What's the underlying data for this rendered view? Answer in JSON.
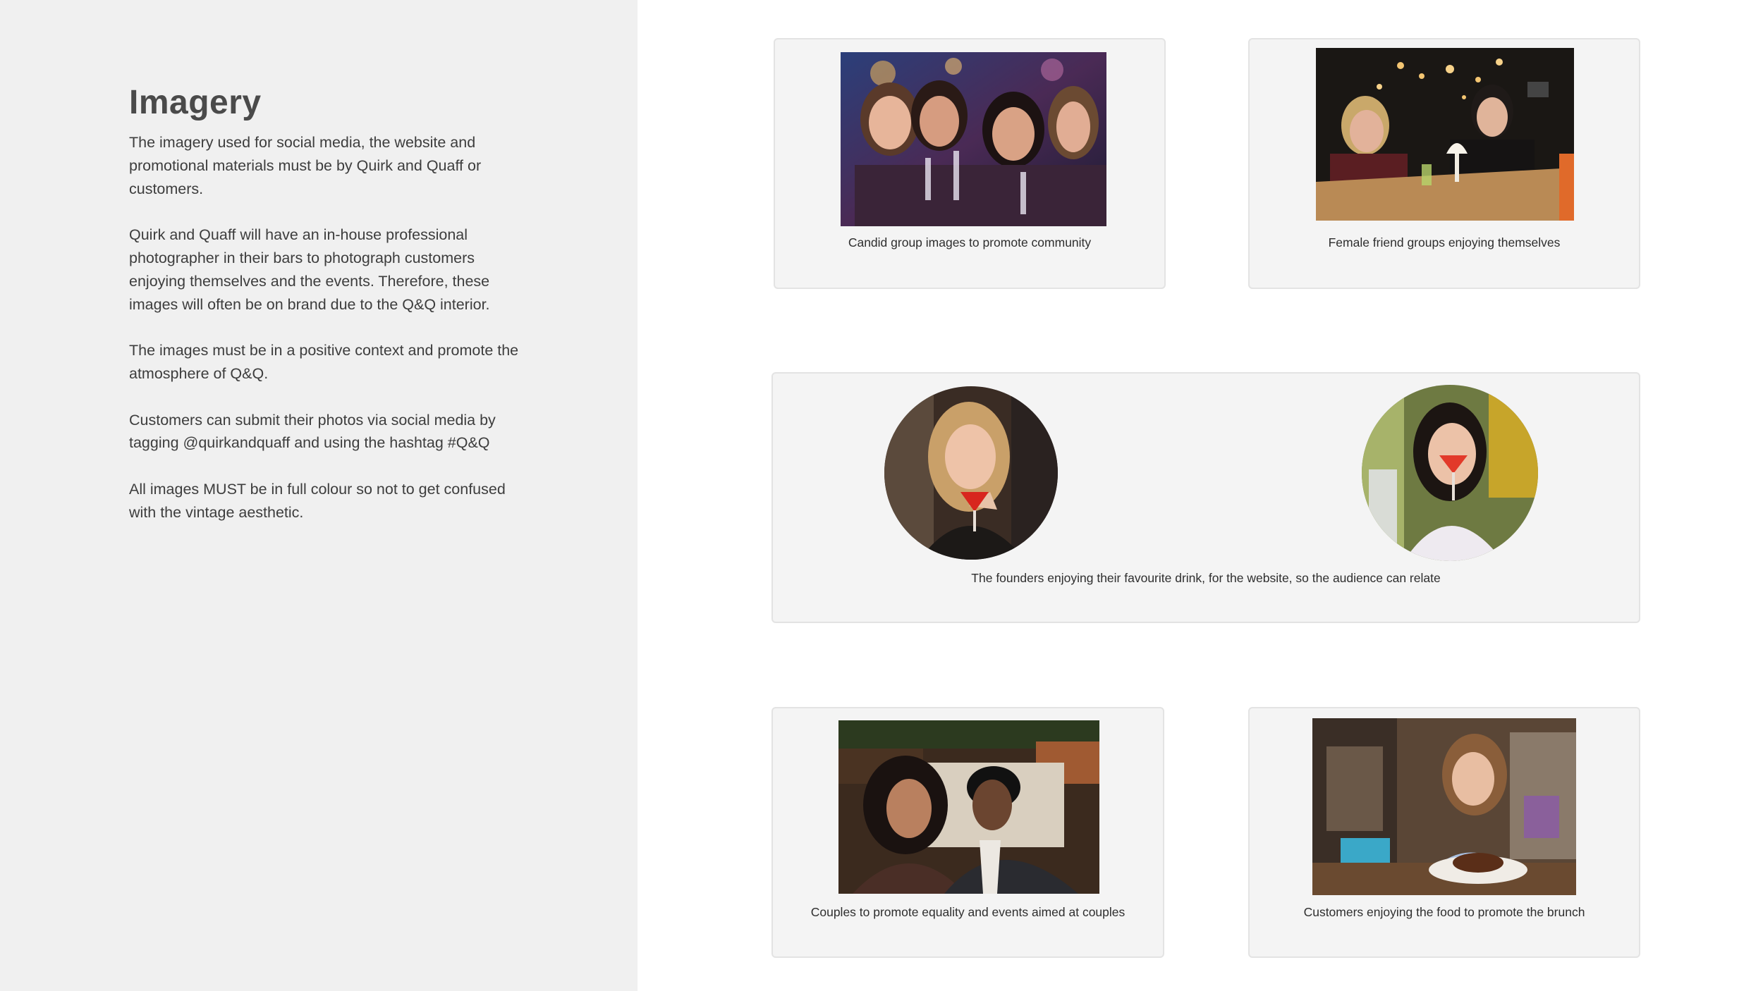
{
  "heading": "Imagery",
  "paragraphs": [
    "The imagery used for social media, the website and promotional materials must be by Quirk and Quaff or customers.",
    "Quirk and Quaff will have an in-house professional photographer in their bars to photograph customers enjoying themselves and the events. Therefore, these images will often be on brand due to the Q&Q interior.",
    "The images must be in a positive context and promote the atmosphere of Q&Q.",
    "Customers can submit their photos via social media by tagging @quirkandquaff and using the hashtag #Q&Q",
    "All images MUST be in full colour so not to get confused with the vintage aesthetic."
  ],
  "cards": [
    {
      "caption": "Candid group images to promote community"
    },
    {
      "caption": "Female friend groups enjoying themselves"
    },
    {
      "caption": "The founders enjoying their favourite drink, for the website, so the audience can relate"
    },
    {
      "caption": "Couples to promote equality and events aimed at couples"
    },
    {
      "caption": "Customers enjoying the food to promote the brunch"
    }
  ]
}
